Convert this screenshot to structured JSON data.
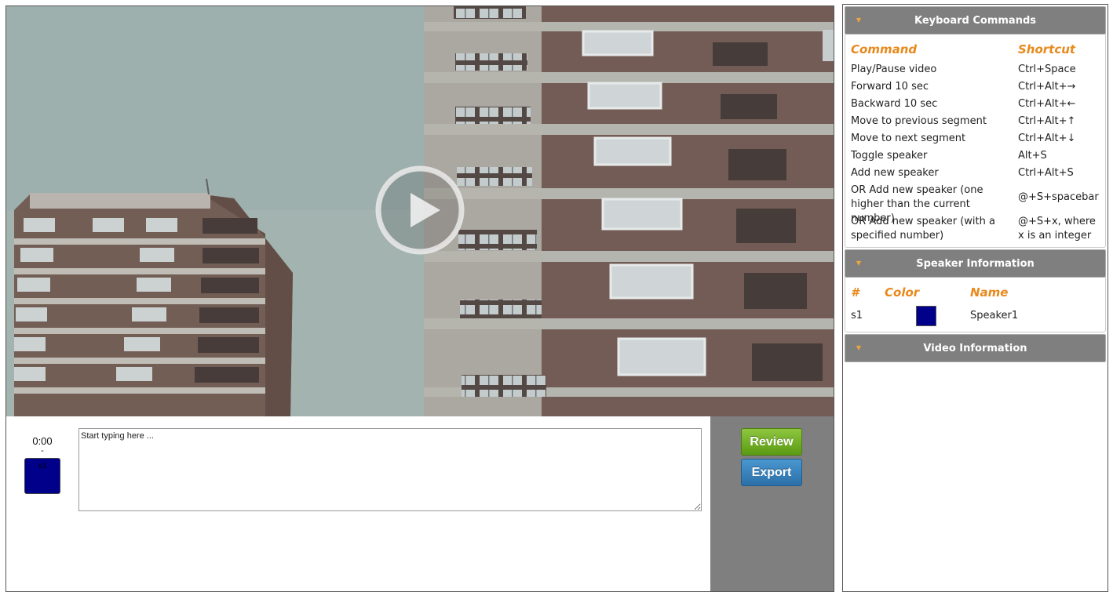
{
  "video": {
    "play_icon": "play-icon"
  },
  "transcript": {
    "segment_time": "0:00",
    "segment_separator": "-",
    "speaker_label": "s1",
    "speaker_color": "#00008b",
    "placeholder": "Start typing here ..."
  },
  "actions": {
    "review_label": "Review",
    "export_label": "Export",
    "review_color": "#6aaa1f",
    "export_color": "#3a85c0"
  },
  "keyboard_commands": {
    "title": "Keyboard Commands",
    "header_command": "Command",
    "header_shortcut": "Shortcut",
    "rows": [
      {
        "command": "Play/Pause video",
        "shortcut": "Ctrl+Space"
      },
      {
        "command": "Forward 10 sec",
        "shortcut": "Ctrl+Alt+→"
      },
      {
        "command": "Backward 10 sec",
        "shortcut": "Ctrl+Alt+←"
      },
      {
        "command": "Move to previous segment",
        "shortcut": "Ctrl+Alt+↑"
      },
      {
        "command": "Move to next segment",
        "shortcut": "Ctrl+Alt+↓"
      },
      {
        "command": "Toggle speaker",
        "shortcut": "Alt+S"
      },
      {
        "command": "Add new speaker",
        "shortcut": "Ctrl+Alt+S"
      },
      {
        "command": "OR Add new speaker (one higher than the current number)",
        "shortcut": "@+S+spacebar"
      },
      {
        "command": "OR Add new speaker (with a specified number)",
        "shortcut": "@+S+x, where x is an integer"
      }
    ]
  },
  "speaker_information": {
    "title": "Speaker Information",
    "header_number": "#",
    "header_color": "Color",
    "header_name": "Name",
    "speakers": [
      {
        "id": "s1",
        "color": "#00008b",
        "name": "Speaker1"
      }
    ]
  },
  "video_information": {
    "title": "Video Information"
  },
  "colors": {
    "accent_orange": "#e8891c",
    "panel_header_gray": "#7f7f7f"
  }
}
